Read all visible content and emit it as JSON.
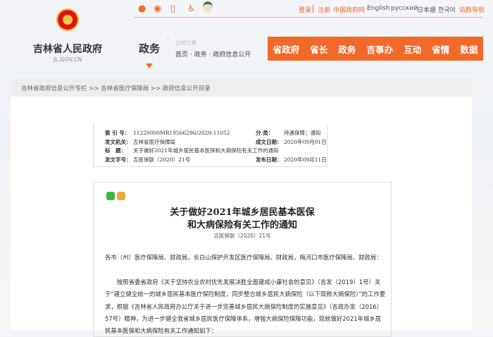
{
  "topbar": {
    "links": [
      {
        "label": "登录",
        "accent": true
      },
      {
        "label": "注册",
        "accent": true
      },
      {
        "label": "中国政府网",
        "accent": true
      },
      {
        "label": "English",
        "accent": false
      },
      {
        "label": "русский",
        "accent": false
      },
      {
        "label": "日本語",
        "accent": false
      },
      {
        "label": "한국어",
        "accent": false
      },
      {
        "label": "站群导航",
        "accent": true
      }
    ],
    "icons": [
      "wechat-icon",
      "weibo-icon",
      "mobile-icon",
      "accessibility-icon",
      "mascot-icon"
    ]
  },
  "header": {
    "site_name": "吉林省人民政府",
    "domain": "JL.GOV.CN",
    "section": "政务",
    "location_label": "当前位置",
    "location": [
      "首页",
      "政务",
      "政府信息公开"
    ]
  },
  "nav": [
    "省政府",
    "省长",
    "政务",
    "吉事办",
    "互动",
    "省情",
    "数据"
  ],
  "breadcrumb": "吉林省政府信息公开专栏 >> 吉林省医疗保障局 >> 政府信息公开目录",
  "meta": {
    "index_label": "索 引 号：",
    "index": "11220000MB19566296/2020-11052",
    "category_label": "分 类：",
    "category": "待遇保障；通知",
    "issuer_label": "发文机关：",
    "issuer": "吉林省医疗保障局",
    "written_label": "成文日期：",
    "written": "2020年09月01日",
    "title_label": "标　题：",
    "title": "关于做好2021年城乡居民基本医保和大病保险有关工作的通知",
    "docno_label": "发文字号：",
    "docno": "吉医保联（2020）21号",
    "published_label": "发布日期：",
    "published": "2020年09月11日"
  },
  "article": {
    "title_line1": "关于做好2021年城乡居民基本医保",
    "title_line2": "和大病保险有关工作的通知",
    "docno": "吉医保联（2020）21号",
    "addressee": "各市（州）医疗保障局、财政局，长白山保护开发区医疗保障局、财政局，梅河口市医疗保障局、财政局：",
    "body": "按照省委省政府《关于坚持农业农村优先发展决胜全面建成小康社会的意见》（吉发（2019）1号）关于“建立健全统一的城乡居民基本医疗保险制度，同步整合城乡居民大病保险（以下简称大病保险）”的工作要求，根据《吉林省人民政府办公厅关于进一步完善城乡居民大病保险制度的实施意见》（吉政办发（2016）57号）精神，为进一步健全我省城乡居民医疗保障体系，增强大病保险保障功能，现就做好2021年城乡居民基本医保和大病保险有关工作通知如下："
  },
  "colors": {
    "accent": "#f26a2a"
  }
}
